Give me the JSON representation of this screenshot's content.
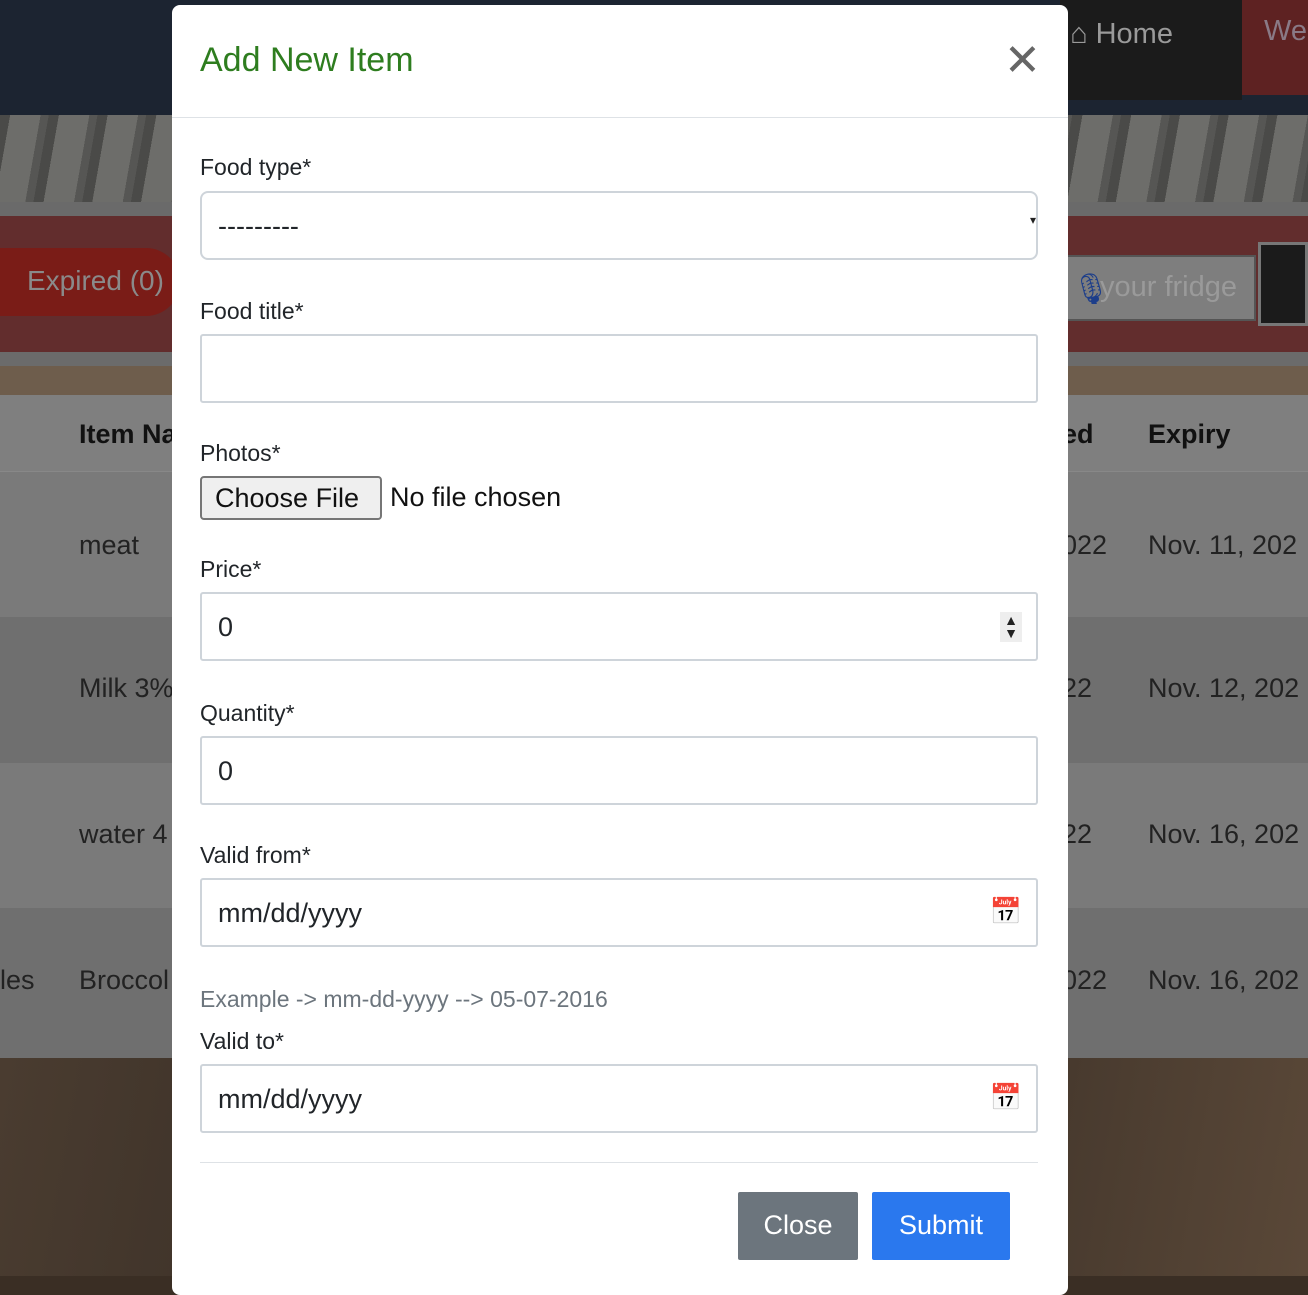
{
  "nav": {
    "home": "Home",
    "welcome": "We"
  },
  "filters": {
    "expired": "Expired (0)"
  },
  "search": {
    "placeholder": "your fridge"
  },
  "table": {
    "headers": [
      "Item Na",
      "ed",
      "Expiry"
    ],
    "rows": [
      {
        "cat": "",
        "name": "meat",
        "added": "022",
        "expiry": "Nov. 11, 202"
      },
      {
        "cat": "",
        "name": "Milk 3%",
        "added": "22",
        "expiry": "Nov. 12, 202"
      },
      {
        "cat": "",
        "name": "water 4",
        "added": "22",
        "expiry": "Nov. 16, 202"
      },
      {
        "cat": "les",
        "name": "Broccol",
        "added": "022",
        "expiry": "Nov. 16, 202"
      }
    ]
  },
  "modal": {
    "title": "Add New Item",
    "food_type": {
      "label": "Food type*",
      "value": "---------"
    },
    "food_title": {
      "label": "Food title*",
      "value": ""
    },
    "photos": {
      "label": "Photos*",
      "button": "Choose File",
      "status": "No file chosen"
    },
    "price": {
      "label": "Price*",
      "value": "0"
    },
    "quantity": {
      "label": "Quantity*",
      "value": "0"
    },
    "valid_from": {
      "label": "Valid from*",
      "placeholder": "mm/dd/yyyy"
    },
    "help": "Example -> mm-dd-yyyy --> 05-07-2016",
    "valid_to": {
      "label": "Valid to*",
      "placeholder": "mm/dd/yyyy"
    },
    "close": "Close",
    "submit": "Submit"
  },
  "colors": {
    "title": "#2e7d1f",
    "submit": "#2a78ee",
    "close": "#6c757d"
  }
}
